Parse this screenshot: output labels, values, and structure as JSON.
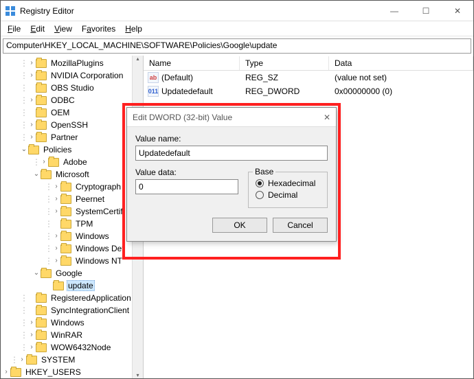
{
  "window": {
    "title": "Registry Editor"
  },
  "menubar": {
    "file": "File",
    "edit": "Edit",
    "view": "View",
    "favorites": "Favorites",
    "help": "Help"
  },
  "address": "Computer\\HKEY_LOCAL_MACHINE\\SOFTWARE\\Policies\\Google\\update",
  "tree": {
    "items": [
      "MozillaPlugins",
      "NVIDIA Corporation",
      "OBS Studio",
      "ODBC",
      "OEM",
      "OpenSSH",
      "Partner",
      "Policies",
      "Adobe",
      "Microsoft",
      "Cryptograph",
      "Peernet",
      "SystemCertif",
      "TPM",
      "Windows",
      "Windows Def",
      "Windows NT",
      "Google",
      "update",
      "RegisteredApplication",
      "SyncIntegrationClient",
      "Windows",
      "WinRAR",
      "WOW6432Node",
      "SYSTEM",
      "HKEY_USERS"
    ]
  },
  "list": {
    "headers": {
      "name": "Name",
      "type": "Type",
      "data": "Data"
    },
    "rows": [
      {
        "name": "(Default)",
        "type": "REG_SZ",
        "data": "(value not set)",
        "icon": "str"
      },
      {
        "name": "Updatedefault",
        "type": "REG_DWORD",
        "data": "0x00000000 (0)",
        "icon": "dw"
      }
    ]
  },
  "dialog": {
    "title": "Edit DWORD (32-bit) Value",
    "name_label": "Value name:",
    "name_value": "Updatedefault",
    "data_label": "Value data:",
    "data_value": "0",
    "base_label": "Base",
    "hex_label": "Hexadecimal",
    "dec_label": "Decimal",
    "ok": "OK",
    "cancel": "Cancel"
  }
}
